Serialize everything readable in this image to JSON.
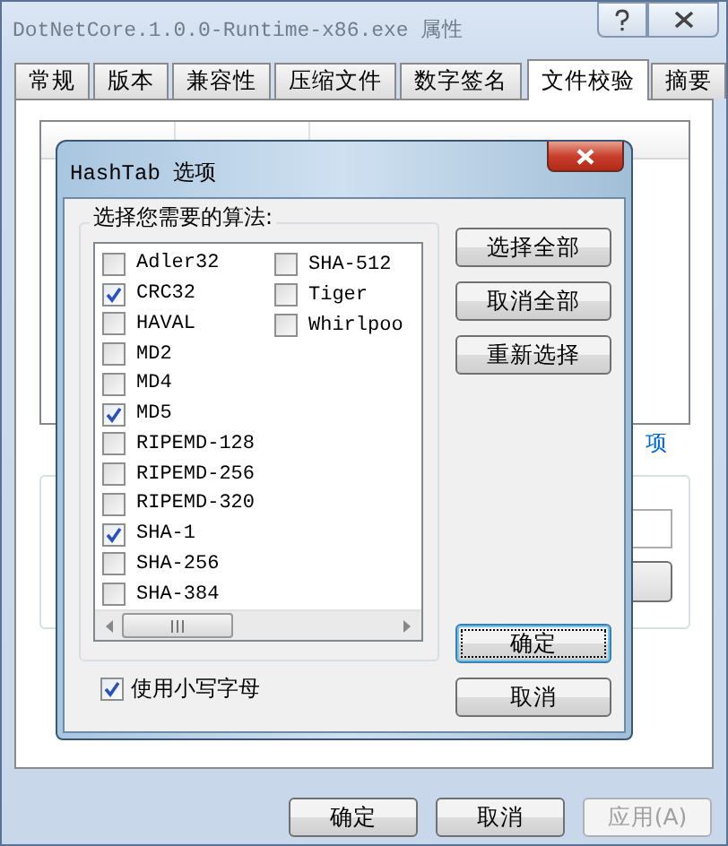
{
  "window": {
    "title": "DotNetCore.1.0.0-Runtime-x86.exe 属性"
  },
  "tabs": [
    {
      "label": "常规",
      "selected": false
    },
    {
      "label": "版本",
      "selected": false
    },
    {
      "label": "兼容性",
      "selected": false
    },
    {
      "label": "压缩文件",
      "selected": false
    },
    {
      "label": "数字签名",
      "selected": false
    },
    {
      "label": "文件校验",
      "selected": true
    },
    {
      "label": "摘要",
      "selected": false
    }
  ],
  "link": "项",
  "buttons": [
    {
      "label": "确定",
      "disabled": false
    },
    {
      "label": "取消",
      "disabled": false
    },
    {
      "label": "应用(A)",
      "disabled": true
    }
  ],
  "dialog": {
    "title": "HashTab 选项",
    "group_label": "选择您需要的算法:",
    "algorithm_columns": [
      [
        {
          "label": "Adler32",
          "checked": false
        },
        {
          "label": "CRC32",
          "checked": true
        },
        {
          "label": "HAVAL",
          "checked": false
        },
        {
          "label": "MD2",
          "checked": false
        },
        {
          "label": "MD4",
          "checked": false
        },
        {
          "label": "MD5",
          "checked": true
        },
        {
          "label": "RIPEMD-128",
          "checked": false
        },
        {
          "label": "RIPEMD-256",
          "checked": false
        },
        {
          "label": "RIPEMD-320",
          "checked": false
        },
        {
          "label": "SHA-1",
          "checked": true
        },
        {
          "label": "SHA-256",
          "checked": false
        },
        {
          "label": "SHA-384",
          "checked": false
        }
      ],
      [
        {
          "label": "SHA-512",
          "checked": false
        },
        {
          "label": "Tiger",
          "checked": false
        },
        {
          "label": "Whirlpoo",
          "checked": false
        }
      ]
    ],
    "side_buttons": [
      "选择全部",
      "取消全部",
      "重新选择"
    ],
    "buttons": [
      {
        "label": "确定",
        "default": true
      },
      {
        "label": "取消",
        "default": false
      }
    ],
    "lowercase": {
      "label": "使用小写字母",
      "checked": true
    }
  }
}
